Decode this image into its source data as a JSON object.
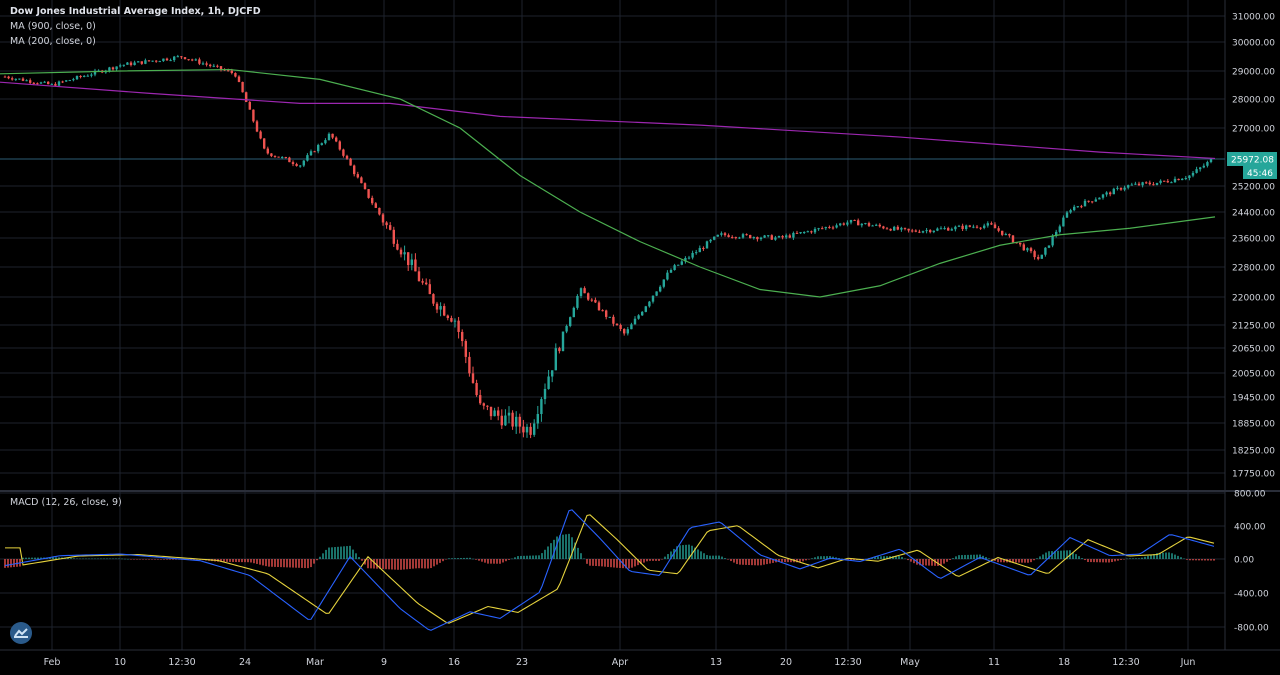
{
  "chart_data": {
    "type": "line",
    "title": "Dow Jones Industrial Average Index, 1h, DJCFD",
    "indicators": {
      "ma900": {
        "label": "MA (900, close, 0)",
        "color": "#9c27b0"
      },
      "ma200": {
        "label": "MA (200, close, 0)",
        "color": "#4caf50"
      }
    },
    "price_axis": {
      "ticks": [
        "31000.00",
        "30000.00",
        "29000.00",
        "28000.00",
        "27000.00",
        "25972.08",
        "25200.00",
        "24400.00",
        "23600.00",
        "22800.00",
        "22000.00",
        "21250.00",
        "20650.00",
        "20050.00",
        "19450.00",
        "18850.00",
        "18250.00",
        "17750.00"
      ],
      "last_price": "25972.08",
      "countdown": "45:46"
    },
    "time_axis": {
      "ticks": [
        "Feb",
        "10",
        "12:30",
        "24",
        "Mar",
        "9",
        "16",
        "23",
        "Apr",
        "13",
        "20",
        "12:30",
        "May",
        "11",
        "18",
        "12:30",
        "Jun"
      ]
    },
    "macd": {
      "label": "MACD (12, 26, close, 9)",
      "ticks": [
        "800.00",
        "400.00",
        "0.00",
        "-400.00",
        "-800.00"
      ],
      "macd_color": "#2962ff",
      "signal_color": "#e5d23d"
    },
    "price_series": {
      "name": "Dow Jones Industrial Average Index",
      "x": [
        "Feb 1",
        "Feb 5",
        "Feb 12",
        "Feb 20",
        "Feb 24",
        "Feb 27",
        "Mar 2",
        "Mar 5",
        "Mar 9",
        "Mar 12",
        "Mar 16",
        "Mar 19",
        "Mar 23",
        "Mar 26",
        "Apr 1",
        "Apr 6",
        "Apr 13",
        "Apr 20",
        "Apr 27",
        "May 4",
        "May 11",
        "May 14",
        "May 18",
        "May 26",
        "May 28",
        "Jun 1",
        "Jun 3"
      ],
      "y": [
        28800,
        28500,
        29200,
        29500,
        28900,
        26200,
        25800,
        26800,
        23800,
        22000,
        21400,
        19200,
        18700,
        22200,
        21000,
        22700,
        23700,
        23600,
        24100,
        23800,
        24000,
        23000,
        24500,
        25200,
        25300,
        25500,
        25972
      ]
    },
    "colors": {
      "up": "#26a69a",
      "down": "#ef5350",
      "grid": "#1e222d",
      "text": "#d1d4dc",
      "last_price": "#26a69a",
      "hline": "#2b5d75"
    }
  }
}
